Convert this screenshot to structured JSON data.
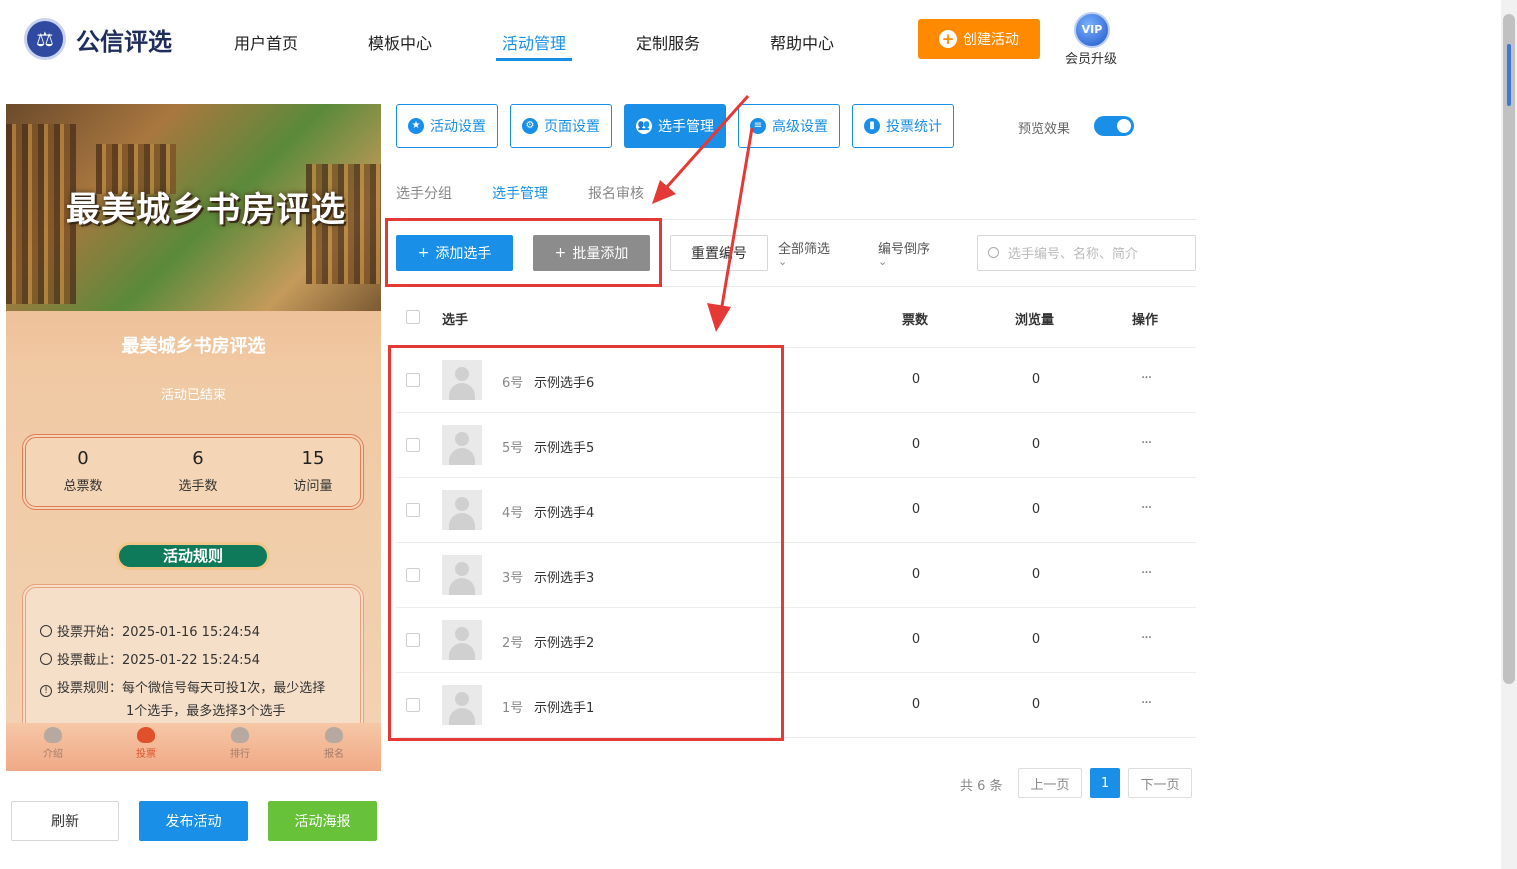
{
  "header": {
    "logo_text": "公信评选",
    "nav": [
      "用户首页",
      "模板中心",
      "活动管理",
      "定制服务",
      "帮助中心"
    ],
    "create_label": "创建活动",
    "vip_badge": "VIP",
    "vip_label": "会员升级"
  },
  "preview": {
    "banner_title": "最美城乡书房评选",
    "title": "最美城乡书房评选",
    "status": "活动已结束",
    "stats": [
      {
        "value": "0",
        "label": "总票数"
      },
      {
        "value": "6",
        "label": "选手数"
      },
      {
        "value": "15",
        "label": "访问量"
      }
    ],
    "rules_title": "活动规则",
    "rules": [
      "投票开始：2025-01-16 15:24:54",
      "投票截止：2025-01-22 15:24:54",
      "投票规则：每个微信号每天可投1次，最少选择",
      "1个选手，最多选择3个选手"
    ],
    "tabs": [
      "介绍",
      "投票",
      "排行",
      "报名"
    ],
    "active_tab": "投票"
  },
  "bottom_buttons": {
    "refresh": "刷新",
    "publish": "发布活动",
    "poster": "活动海报"
  },
  "settings_tabs": [
    "活动设置",
    "页面设置",
    "选手管理",
    "高级设置",
    "投票统计"
  ],
  "preview_toggle": {
    "label": "预览效果",
    "on": true
  },
  "sub_tabs": [
    "选手分组",
    "选手管理",
    "报名审核"
  ],
  "toolbar": {
    "add_label": "添加选手",
    "batch_label": "批量添加",
    "reset_label": "重置编号",
    "filter_label": "全部筛选",
    "sort_label": "编号倒序",
    "search_placeholder": "选手编号、名称、简介"
  },
  "table": {
    "headers": {
      "player": "选手",
      "votes": "票数",
      "views": "浏览量",
      "ops": "操作"
    },
    "rows": [
      {
        "num": "6号",
        "name": "示例选手6",
        "votes": "0",
        "views": "0"
      },
      {
        "num": "5号",
        "name": "示例选手5",
        "votes": "0",
        "views": "0"
      },
      {
        "num": "4号",
        "name": "示例选手4",
        "votes": "0",
        "views": "0"
      },
      {
        "num": "3号",
        "name": "示例选手3",
        "votes": "0",
        "views": "0"
      },
      {
        "num": "2号",
        "name": "示例选手2",
        "votes": "0",
        "views": "0"
      },
      {
        "num": "1号",
        "name": "示例选手1",
        "votes": "0",
        "views": "0"
      }
    ],
    "more_icon": "···"
  },
  "pagination": {
    "total": "共 6 条",
    "prev": "上一页",
    "current": "1",
    "next": "下一页"
  },
  "colors": {
    "primary": "#1a8fe8",
    "orange": "#ff8a00",
    "green": "#67c23a",
    "annotation_red": "#e53935"
  }
}
